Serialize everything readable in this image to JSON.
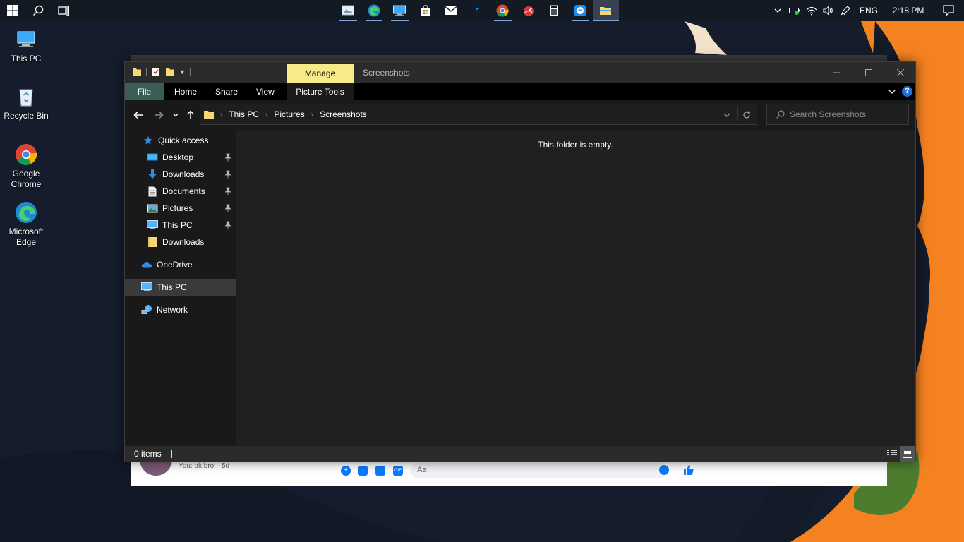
{
  "taskbar": {
    "start_icon": "windows-logo-icon",
    "search_icon": "search-icon",
    "taskview_icon": "task-view-icon",
    "pinned_apps": [
      "photos-icon",
      "edge-icon",
      "remote-desktop-icon",
      "store-icon",
      "mail-icon",
      "edge-dev-icon",
      "chrome-icon",
      "speedtest-icon",
      "calculator-icon",
      "messenger-icon",
      "file-explorer-icon"
    ],
    "language": "ENG",
    "time": "2:18 PM"
  },
  "desktop": {
    "icons": [
      {
        "label": "This PC",
        "icon": "this-pc-icon"
      },
      {
        "label": "Recycle Bin",
        "icon": "recycle-bin-icon"
      },
      {
        "label": "Google Chrome",
        "icon": "chrome-icon"
      },
      {
        "label": "Microsoft Edge",
        "icon": "edge-icon"
      }
    ]
  },
  "messenger": {
    "preview": "You: ok bro' · 5d",
    "placeholder": "Aa"
  },
  "explorer": {
    "context_tab": "Manage",
    "window_title": "Screenshots",
    "ribbon_tabs": [
      "File",
      "Home",
      "Share",
      "View",
      "Picture Tools"
    ],
    "breadcrumb": [
      "This PC",
      "Pictures",
      "Screenshots"
    ],
    "search_placeholder": "Search Screenshots",
    "nav": {
      "quick_access": "Quick access",
      "pinned": [
        "Desktop",
        "Downloads",
        "Documents",
        "Pictures",
        "This PC"
      ],
      "recent": "Downloads",
      "onedrive": "OneDrive",
      "this_pc": "This PC",
      "network": "Network"
    },
    "empty_message": "This folder is empty.",
    "status": "0 items"
  }
}
